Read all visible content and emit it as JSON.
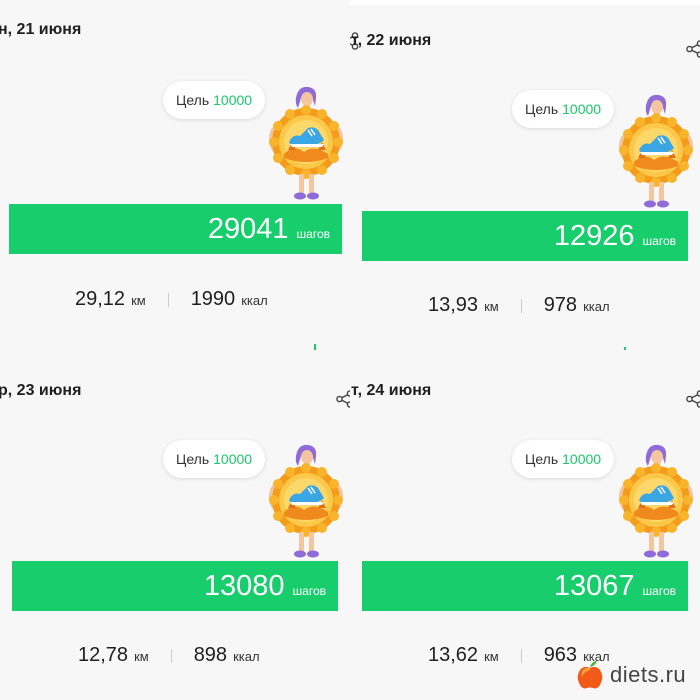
{
  "days": [
    {
      "date": "н, 21 июня",
      "goal_label": "Цель",
      "goal_value": "10000",
      "steps": "29041",
      "steps_unit": "шагов",
      "distance": "29,12",
      "distance_unit": "км",
      "calories": "1990",
      "calories_unit": "ккал"
    },
    {
      "date": "т, 22 июня",
      "goal_label": "Цель",
      "goal_value": "10000",
      "steps": "12926",
      "steps_unit": "шагов",
      "distance": "13,93",
      "distance_unit": "км",
      "calories": "978",
      "calories_unit": "ккал"
    },
    {
      "date": "р, 23 июня",
      "goal_label": "Цель",
      "goal_value": "10000",
      "steps": "13080",
      "steps_unit": "шагов",
      "distance": "12,78",
      "distance_unit": "км",
      "calories": "898",
      "calories_unit": "ккал"
    },
    {
      "date": "т, 24 июня",
      "goal_label": "Цель",
      "goal_value": "10000",
      "steps": "13067",
      "steps_unit": "шагов",
      "distance": "13,62",
      "distance_unit": "км",
      "calories": "963",
      "calories_unit": "ккал"
    }
  ],
  "icons": {
    "share": "share-icon",
    "mascot": "runner-badge-illustration",
    "logo": "apple-logo-icon"
  },
  "colors": {
    "accent": "#18cd6b",
    "goal": "#18c96a",
    "background": "#f7f7f7"
  },
  "watermark": {
    "text": "diets.ru"
  }
}
